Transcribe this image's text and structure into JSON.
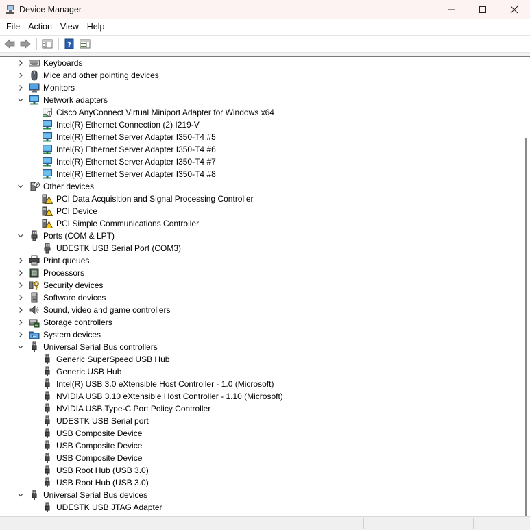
{
  "window": {
    "title": "Device Manager"
  },
  "menu": [
    "File",
    "Action",
    "View",
    "Help"
  ],
  "tree": [
    {
      "level": 0,
      "state": "collapsed",
      "icon": "keyboard-icon",
      "label": "Keyboards"
    },
    {
      "level": 0,
      "state": "collapsed",
      "icon": "mouse-icon",
      "label": "Mice and other pointing devices"
    },
    {
      "level": 0,
      "state": "collapsed",
      "icon": "monitor-icon",
      "label": "Monitors"
    },
    {
      "level": 0,
      "state": "expanded",
      "icon": "network-adapter-icon",
      "label": "Network adapters"
    },
    {
      "level": 1,
      "state": "leaf",
      "icon": "virtual-adapter-icon",
      "label": "Cisco AnyConnect Virtual Miniport Adapter for Windows x64"
    },
    {
      "level": 1,
      "state": "leaf",
      "icon": "network-adapter-icon",
      "label": "Intel(R) Ethernet Connection (2) I219-V"
    },
    {
      "level": 1,
      "state": "leaf",
      "icon": "network-adapter-icon",
      "label": "Intel(R) Ethernet Server Adapter I350-T4 #5"
    },
    {
      "level": 1,
      "state": "leaf",
      "icon": "network-adapter-icon",
      "label": "Intel(R) Ethernet Server Adapter I350-T4 #6"
    },
    {
      "level": 1,
      "state": "leaf",
      "icon": "network-adapter-icon",
      "label": "Intel(R) Ethernet Server Adapter I350-T4 #7"
    },
    {
      "level": 1,
      "state": "leaf",
      "icon": "network-adapter-icon",
      "label": "Intel(R) Ethernet Server Adapter I350-T4 #8"
    },
    {
      "level": 0,
      "state": "expanded",
      "icon": "other-devices-icon",
      "label": "Other devices"
    },
    {
      "level": 1,
      "state": "leaf",
      "icon": "warning-device-icon",
      "label": "PCI Data Acquisition and Signal Processing Controller"
    },
    {
      "level": 1,
      "state": "leaf",
      "icon": "warning-device-icon",
      "label": "PCI Device"
    },
    {
      "level": 1,
      "state": "leaf",
      "icon": "warning-device-icon",
      "label": "PCI Simple Communications Controller"
    },
    {
      "level": 0,
      "state": "expanded",
      "icon": "port-icon",
      "label": "Ports (COM & LPT)"
    },
    {
      "level": 1,
      "state": "leaf",
      "icon": "port-icon",
      "label": "UDESTK USB Serial Port (COM3)"
    },
    {
      "level": 0,
      "state": "collapsed",
      "icon": "printer-icon",
      "label": "Print queues"
    },
    {
      "level": 0,
      "state": "collapsed",
      "icon": "processor-icon",
      "label": "Processors"
    },
    {
      "level": 0,
      "state": "collapsed",
      "icon": "security-key-icon",
      "label": "Security devices"
    },
    {
      "level": 0,
      "state": "collapsed",
      "icon": "software-device-icon",
      "label": "Software devices"
    },
    {
      "level": 0,
      "state": "collapsed",
      "icon": "speaker-icon",
      "label": "Sound, video and game controllers"
    },
    {
      "level": 0,
      "state": "collapsed",
      "icon": "storage-icon",
      "label": "Storage controllers"
    },
    {
      "level": 0,
      "state": "collapsed",
      "icon": "system-folder-icon",
      "label": "System devices"
    },
    {
      "level": 0,
      "state": "expanded",
      "icon": "usb-icon",
      "label": "Universal Serial Bus controllers"
    },
    {
      "level": 1,
      "state": "leaf",
      "icon": "usb-icon",
      "label": "Generic SuperSpeed USB Hub"
    },
    {
      "level": 1,
      "state": "leaf",
      "icon": "usb-icon",
      "label": "Generic USB Hub"
    },
    {
      "level": 1,
      "state": "leaf",
      "icon": "usb-icon",
      "label": "Intel(R) USB 3.0 eXtensible Host Controller - 1.0 (Microsoft)"
    },
    {
      "level": 1,
      "state": "leaf",
      "icon": "usb-icon",
      "label": "NVIDIA USB 3.10 eXtensible Host Controller - 1.10 (Microsoft)"
    },
    {
      "level": 1,
      "state": "leaf",
      "icon": "usb-icon",
      "label": "NVIDIA USB Type-C Port Policy Controller"
    },
    {
      "level": 1,
      "state": "leaf",
      "icon": "usb-icon",
      "label": "UDESTK USB Serial port"
    },
    {
      "level": 1,
      "state": "leaf",
      "icon": "usb-icon",
      "label": "USB Composite Device"
    },
    {
      "level": 1,
      "state": "leaf",
      "icon": "usb-icon",
      "label": "USB Composite Device"
    },
    {
      "level": 1,
      "state": "leaf",
      "icon": "usb-icon",
      "label": "USB Composite Device"
    },
    {
      "level": 1,
      "state": "leaf",
      "icon": "usb-icon",
      "label": "USB Root Hub (USB 3.0)"
    },
    {
      "level": 1,
      "state": "leaf",
      "icon": "usb-icon",
      "label": "USB Root Hub (USB 3.0)"
    },
    {
      "level": 0,
      "state": "expanded",
      "icon": "usb-icon",
      "label": "Universal Serial Bus devices"
    },
    {
      "level": 1,
      "state": "leaf",
      "icon": "usb-icon",
      "label": "UDESTK USB JTAG Adapter"
    }
  ]
}
